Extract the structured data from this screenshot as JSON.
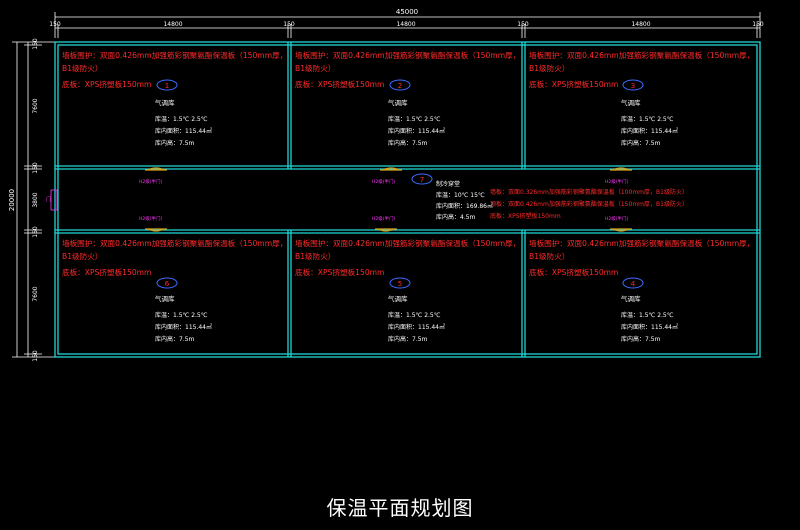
{
  "title": "保温平面规划图",
  "colors": {
    "wall": "#1fd6d6",
    "text_red": "#ff2a2a",
    "door": "#d9a21a",
    "door_label": "#ff33ff",
    "marker": "#3f6bff",
    "dim": "#ffffff"
  },
  "dimensions": {
    "total_width": "45000",
    "top": [
      "150",
      "14800",
      "150",
      "14800",
      "150",
      "14800",
      "150"
    ],
    "total_height": "20000",
    "left": [
      "150",
      "7600",
      "150",
      "3800",
      "150",
      "7600",
      "150"
    ]
  },
  "rooms": [
    {
      "id": "1",
      "wall": "墙板围护：双面0.426mm加强筋彩钢聚氨酯保温板（150mm厚，",
      "wall2": "B1级防火）",
      "floor": "底板：XPS挤塑板150mm",
      "name": "气调库",
      "temp": "库温：1.5℃ 2.5℃",
      "area": "库内面积：115.44㎡",
      "height": "库内高：7.5m"
    },
    {
      "id": "2",
      "wall": "墙板围护：双面0.426mm加强筋彩钢聚氨酯保温板（150mm厚，",
      "wall2": "B1级防火）",
      "floor": "底板：XPS挤塑板150mm",
      "name": "气调库",
      "temp": "库温：1.5℃ 2.5℃",
      "area": "库内面积：115.44㎡",
      "height": "库内高：7.5m"
    },
    {
      "id": "3",
      "wall": "墙板围护：双面0.426mm加强筋彩钢聚氨酯保温板（150mm厚，",
      "wall2": "B1级防火）",
      "floor": "底板：XPS挤塑板150mm",
      "name": "气调库",
      "temp": "库温：1.5℃ 2.5℃",
      "area": "库内面积：115.44㎡",
      "height": "库内高：7.5m"
    },
    {
      "id": "6",
      "wall": "墙板围护：双面0.426mm加强筋彩钢聚氨酯保温板（150mm厚，",
      "wall2": "B1级防火）",
      "floor": "底板：XPS挤塑板150mm",
      "name": "气调库",
      "temp": "库温：1.5℃ 2.5℃",
      "area": "库内面积：115.44㎡",
      "height": "库内高：7.5m"
    },
    {
      "id": "5",
      "wall": "墙板围护：双面0.426mm加强筋彩钢聚氨酯保温板（150mm厚，",
      "wall2": "B1级防火）",
      "floor": "底板：XPS挤塑板150mm",
      "name": "气调库",
      "temp": "库温：1.5℃ 2.5℃",
      "area": "库内面积：115.44㎡",
      "height": "库内高：7.5m"
    },
    {
      "id": "4",
      "wall": "墙板围护：双面0.426mm加强筋彩钢聚氨酯保温板（150mm厚，",
      "wall2": "B1级防火）",
      "floor": "底板：XPS挤塑板150mm",
      "name": "气调库",
      "temp": "库温：1.5℃ 2.5℃",
      "area": "库内面积：115.44㎡",
      "height": "库内高：7.5m"
    }
  ],
  "corridor": {
    "id": "7",
    "name": "制冷穿堂",
    "temp": "库温：10℃ 15℃",
    "area": "库内面积：169.86㎡",
    "height": "库内高：4.5m",
    "wall": "墙板：双面0.326mm加强筋彩钢聚氨酯保温板（100mm厚，B1级防火）",
    "ceiling": "顶板：双面0.426mm加强筋彩钢聚氨酯保温板（150mm厚，B1级防火）",
    "floor": "底板：XPS挤塑板150mm"
  },
  "doors": {
    "label": "H2级(半门)",
    "left_door": "门",
    "positions": [
      "top-left",
      "top-center",
      "top-right",
      "bottom-left",
      "bottom-center",
      "bottom-right",
      "left"
    ]
  }
}
